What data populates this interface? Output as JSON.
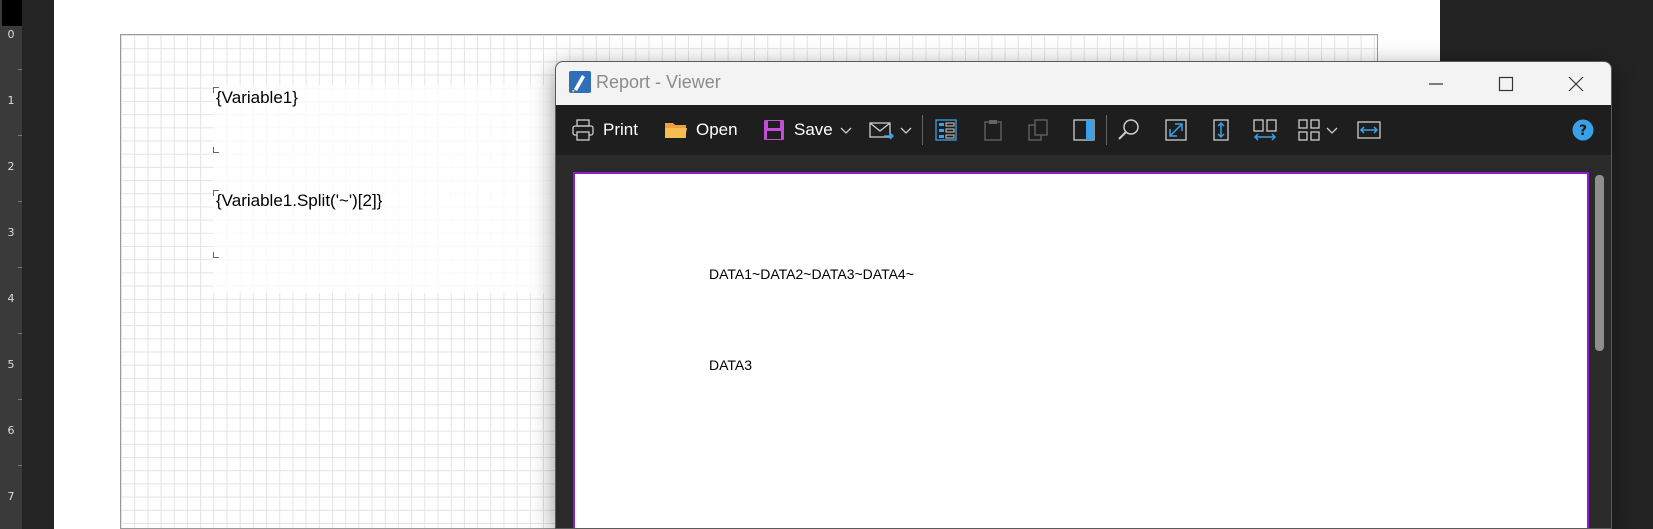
{
  "ruler": {
    "numbers": [
      "0",
      "1",
      "2",
      "3",
      "4",
      "5",
      "6",
      "7"
    ]
  },
  "designer": {
    "field1": "{Variable1}",
    "field2": "{Variable1.Split('~')[2]}"
  },
  "viewer": {
    "title": "Report - Viewer",
    "toolbar": {
      "print_label": "Print",
      "open_label": "Open",
      "save_label": "Save"
    },
    "output": {
      "line1": "DATA1~DATA2~DATA3~DATA4~",
      "line2": "DATA3"
    }
  },
  "colors": {
    "accent_blue": "#3aa0e8",
    "sheet_border": "#8a1fd1",
    "save_icon": "#c04fd6",
    "folder": "#e8a33c"
  }
}
